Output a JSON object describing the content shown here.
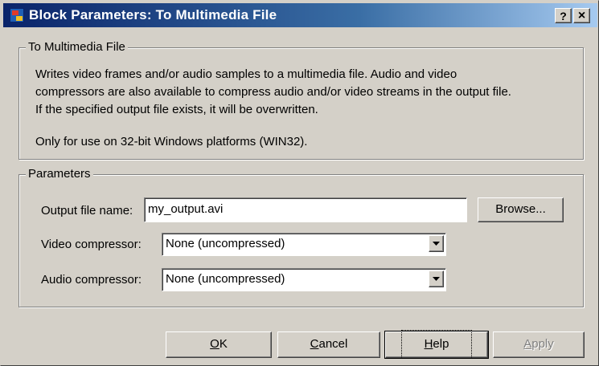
{
  "window": {
    "title": "Block Parameters: To Multimedia File",
    "help_button": "?",
    "close_button": "×"
  },
  "description_group": {
    "legend": "To Multimedia File",
    "lines": [
      "Writes video frames and/or audio samples to a multimedia file.  Audio and video",
      "compressors are also available to compress audio and/or video streams in the output file.",
      "If the specified output file exists, it will be overwritten.",
      "Only for use on 32-bit Windows platforms (WIN32)."
    ]
  },
  "parameters_group": {
    "legend": "Parameters",
    "output_file": {
      "label": "Output file name:",
      "value": "my_output.avi",
      "browse_label": "Browse..."
    },
    "video_compressor": {
      "label": "Video compressor:",
      "value": "None (uncompressed)"
    },
    "audio_compressor": {
      "label": "Audio compressor:",
      "value": "None (uncompressed)"
    }
  },
  "buttons": {
    "ok": {
      "mnemonic": "O",
      "rest": "K"
    },
    "cancel": {
      "mnemonic": "C",
      "rest": "ancel"
    },
    "help": {
      "mnemonic": "H",
      "rest": "elp"
    },
    "apply": {
      "mnemonic": "A",
      "rest": "pply",
      "disabled": true
    }
  }
}
